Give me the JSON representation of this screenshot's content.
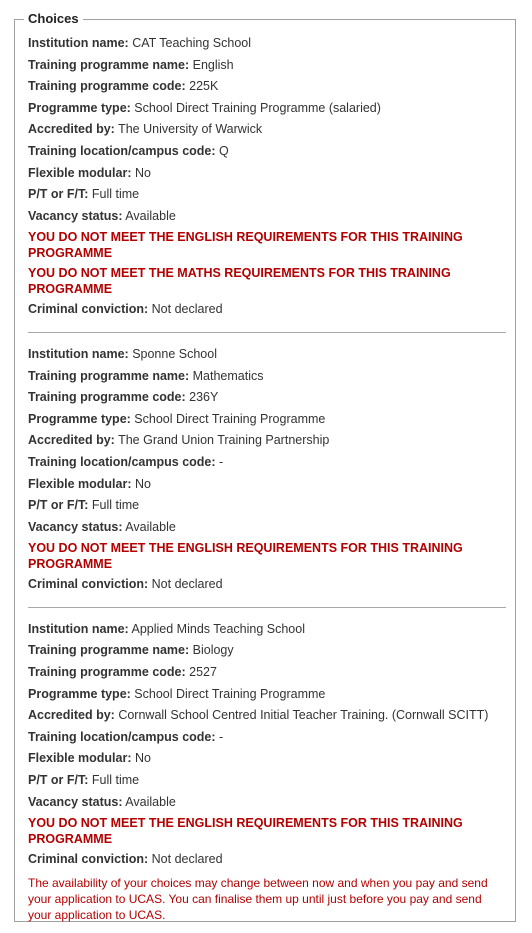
{
  "legend": "Choices",
  "labels": {
    "institution": "Institution name:",
    "programme_name": "Training programme name:",
    "programme_code": "Training programme code:",
    "programme_type": "Programme type:",
    "accredited_by": "Accredited by:",
    "location": "Training location/campus code:",
    "flexible": "Flexible modular:",
    "ptft": "P/T or F/T:",
    "vacancy": "Vacancy status:",
    "criminal": "Criminal conviction:"
  },
  "choices": [
    {
      "institution": "CAT Teaching School",
      "programme_name": "English",
      "programme_code": "225K",
      "programme_type": "School Direct Training Programme (salaried)",
      "accredited_by": "The University of Warwick",
      "location": "Q",
      "flexible": "No",
      "ptft": "Full time",
      "vacancy": "Available",
      "warnings": [
        "YOU DO NOT MEET THE ENGLISH REQUIREMENTS FOR THIS TRAINING PROGRAMME",
        "YOU DO NOT MEET THE MATHS REQUIREMENTS FOR THIS TRAINING PROGRAMME"
      ],
      "criminal": "Not declared"
    },
    {
      "institution": "Sponne School",
      "programme_name": "Mathematics",
      "programme_code": "236Y",
      "programme_type": "School Direct Training Programme",
      "accredited_by": "The Grand Union Training Partnership",
      "location": "-",
      "flexible": "No",
      "ptft": "Full time",
      "vacancy": "Available",
      "warnings": [
        "YOU DO NOT MEET THE ENGLISH REQUIREMENTS FOR THIS TRAINING PROGRAMME"
      ],
      "criminal": "Not declared"
    },
    {
      "institution": "Applied Minds Teaching School",
      "programme_name": "Biology",
      "programme_code": "2527",
      "programme_type": "School Direct Training Programme",
      "accredited_by": "Cornwall School Centred Initial Teacher Training. (Cornwall SCITT)",
      "location": "-",
      "flexible": "No",
      "ptft": "Full time",
      "vacancy": "Available",
      "warnings": [
        "YOU DO NOT MEET THE ENGLISH REQUIREMENTS FOR THIS TRAINING PROGRAMME"
      ],
      "criminal": "Not declared"
    }
  ],
  "note": "The availability of your choices may change between now and when you pay and send your application to UCAS. You can finalise them up until just before you pay and send your application to UCAS.",
  "colors": {
    "warning": "#b30000",
    "border": "#a0a0a0",
    "text": "#333333"
  }
}
